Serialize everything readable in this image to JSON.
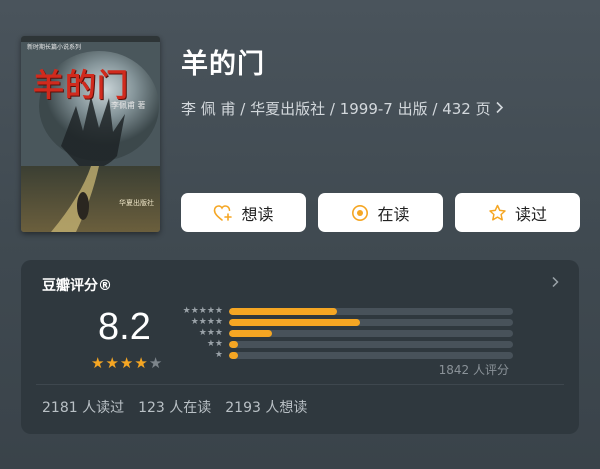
{
  "book": {
    "title": "羊的门",
    "meta": "李 佩 甫 / 华夏出版社 / 1999-7 出版 / 432 页",
    "cover": {
      "title_text": "羊的门",
      "author_text": "李佩甫 著",
      "series_text": "新时期长篇小说系列",
      "publisher_text": "华夏出版社"
    }
  },
  "actions": [
    {
      "label": "想读",
      "icon": "heart-plus-icon"
    },
    {
      "label": "在读",
      "icon": "circle-dot-icon"
    },
    {
      "label": "读过",
      "icon": "star-outline-icon"
    }
  ],
  "rating": {
    "title": "豆瓣评分®",
    "score": "8.2",
    "stars_filled": 4,
    "stars_total": 5,
    "distribution": [
      {
        "stars": 5,
        "fraction": 0.38
      },
      {
        "stars": 4,
        "fraction": 0.46
      },
      {
        "stars": 3,
        "fraction": 0.15
      },
      {
        "stars": 2,
        "fraction": 0.03
      },
      {
        "stars": 1,
        "fraction": 0.03
      }
    ],
    "count_text": "1842 人评分",
    "accent_color": "#f5a623"
  },
  "stats": {
    "read": "2181 人读过",
    "reading": "123 人在读",
    "want": "2193 人想读"
  }
}
